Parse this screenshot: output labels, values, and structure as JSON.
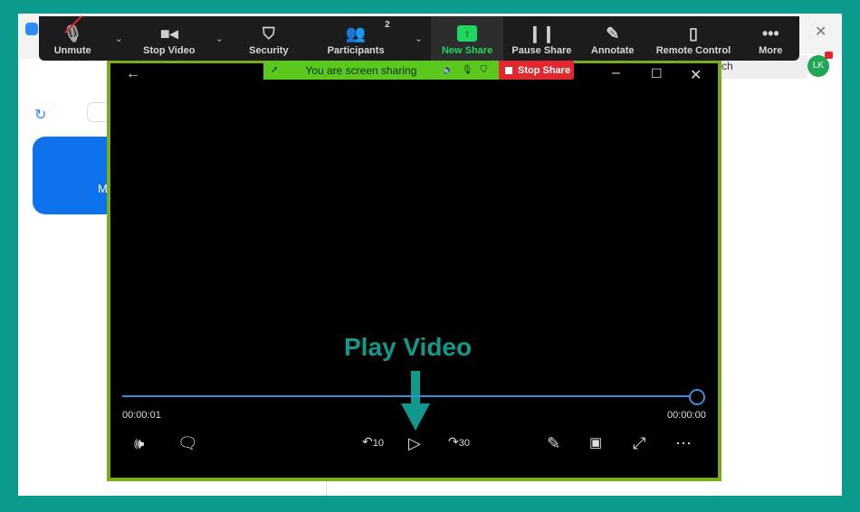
{
  "toolbar": {
    "items": [
      {
        "label": "Unmute",
        "icon": "mic-muted-icon"
      },
      {
        "label": "Stop Video",
        "icon": "video-icon"
      },
      {
        "label": "Security",
        "icon": "shield-icon"
      },
      {
        "label": "Participants",
        "icon": "participants-icon",
        "count": "2"
      },
      {
        "label": "New Share",
        "icon": "share-up-icon"
      },
      {
        "label": "Pause Share",
        "icon": "pause-icon"
      },
      {
        "label": "Annotate",
        "icon": "pencil-icon"
      },
      {
        "label": "Remote Control",
        "icon": "mouse-icon"
      },
      {
        "label": "More",
        "icon": "more-icon"
      }
    ]
  },
  "share_bar": {
    "text": "You are screen sharing",
    "stop": "Stop Share"
  },
  "background": {
    "search_fragment": "ch",
    "avatar": "LK",
    "button_fragment": "M"
  },
  "annotation": {
    "text": "Play Video",
    "color": "#11998c"
  },
  "player": {
    "current_time": "00:00:01",
    "end_time": "00:00:00",
    "progress": 1.0,
    "skip_back": "10",
    "skip_forward": "30"
  },
  "colors": {
    "border": "#0b9b8d",
    "window_border": "#7aab1e",
    "share_green": "#5ac81c",
    "stop_red": "#e0282e",
    "accent": "#3a8fd6"
  }
}
